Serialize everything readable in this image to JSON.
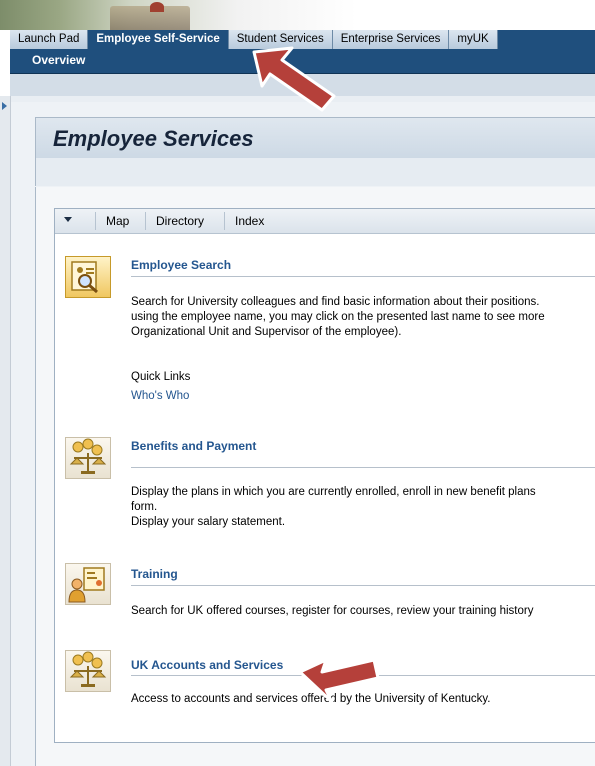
{
  "portal": {
    "tabs": [
      {
        "label": "Launch Pad"
      },
      {
        "label": "Employee Self-Service"
      },
      {
        "label": "Student Services"
      },
      {
        "label": "Enterprise Services"
      },
      {
        "label": "myUK"
      }
    ],
    "active_tab_index": 1,
    "subnav": {
      "overview": "Overview"
    }
  },
  "page": {
    "title": "Employee Services"
  },
  "panel": {
    "tabs": {
      "map": "Map",
      "directory": "Directory",
      "index": "Index"
    }
  },
  "services": {
    "employee_search": {
      "title": "Employee Search",
      "desc": [
        "Search for University colleagues and find basic information about their positions.",
        "using the employee name, you may click on the presented last name to see more",
        "Organizational Unit and Supervisor of the employee)."
      ],
      "quick_links_label": "Quick Links",
      "quick_link": "Who's Who"
    },
    "benefits": {
      "title": "Benefits and Payment",
      "desc": [
        "Display the plans in which you are currently enrolled, enroll in new benefit plans",
        "form.",
        "Display your salary statement."
      ]
    },
    "training": {
      "title": "Training",
      "desc": [
        "Search for UK offered courses, register for courses, review your training history"
      ]
    },
    "accounts": {
      "title": "UK Accounts and Services",
      "desc": [
        "Access to accounts and services offered by the University of Kentucky."
      ]
    }
  },
  "colors": {
    "nav_blue": "#1f4f7d",
    "link_blue": "#24568f",
    "annotation_red": "#b5403a"
  }
}
